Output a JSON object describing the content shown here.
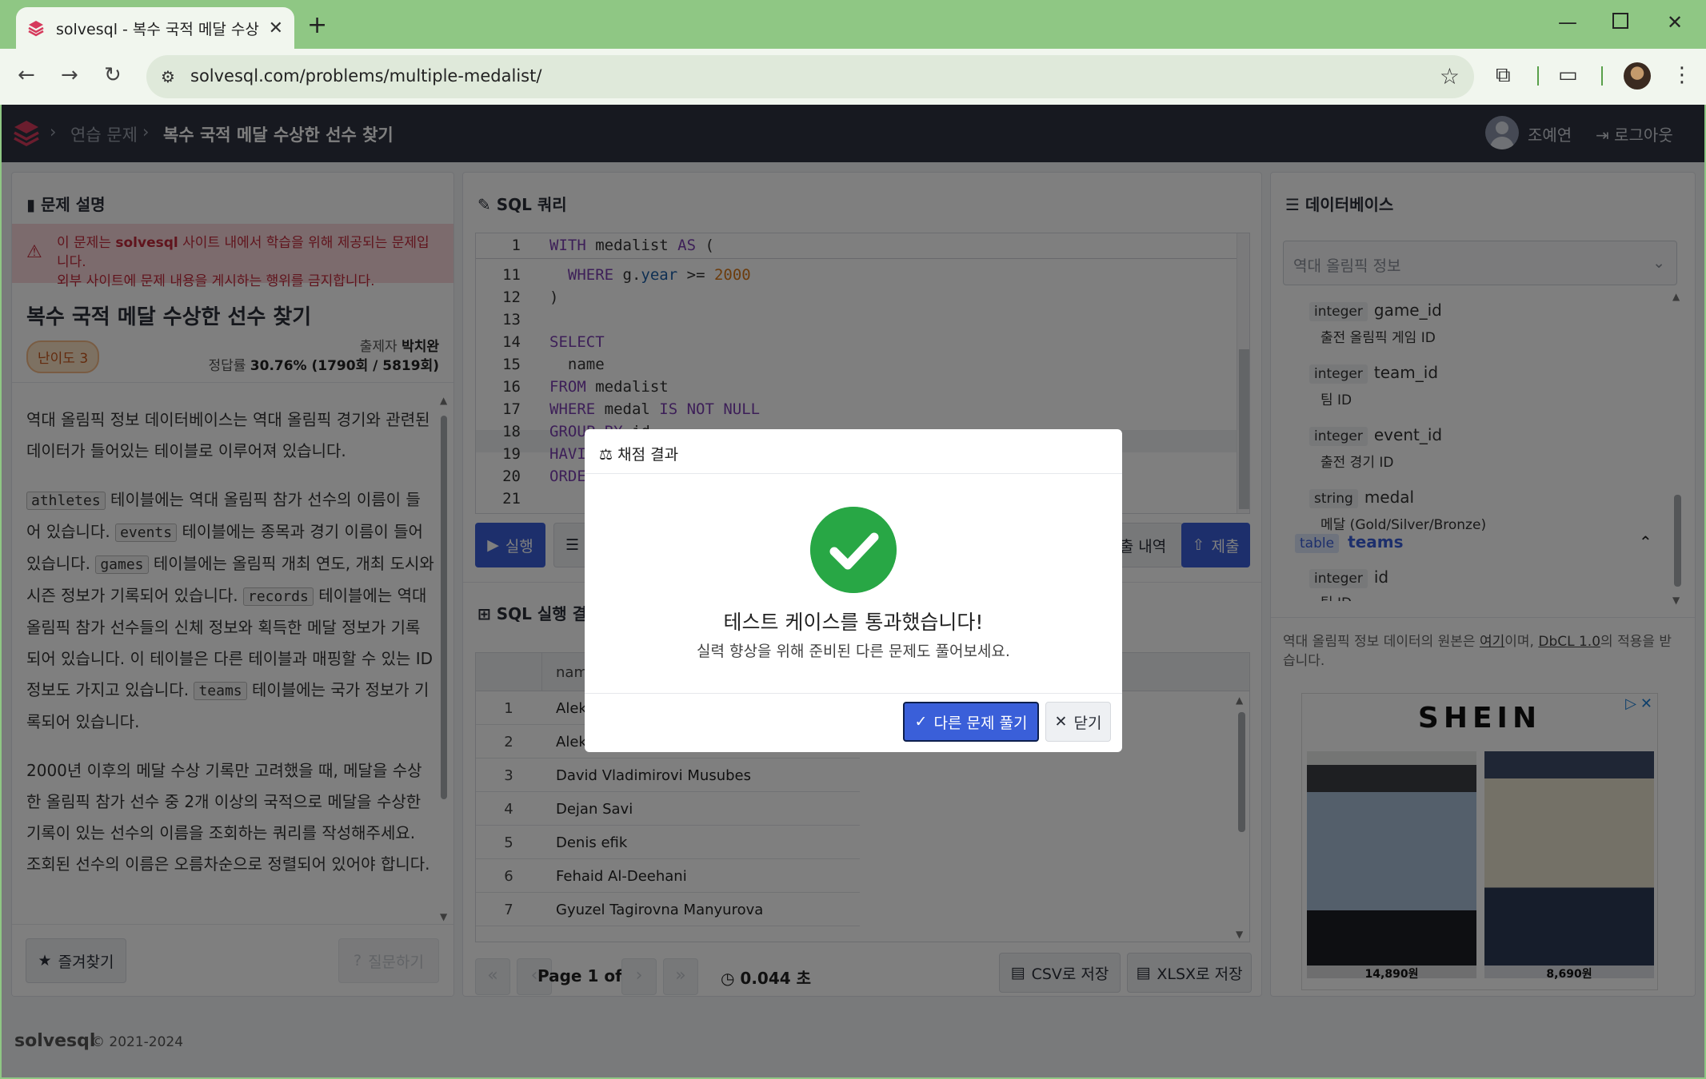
{
  "browser": {
    "tab_title": "solvesql - 복수 국적 메달 수상",
    "url": "solvesql.com/problems/multiple-medalist/"
  },
  "header": {
    "crumb_parent": "연습 문제",
    "crumb_current": "복수 국적 메달 수상한 선수 찾기",
    "user_name": "조예연",
    "logout": "로그아웃"
  },
  "problem": {
    "panel_title": "문제 설명",
    "alert_line1_pre": "이 문제는 ",
    "alert_brand": "solvesql",
    "alert_line1_post": " 사이트 내에서 학습을 위해 제공되는 문제입니다.",
    "alert_line2": "외부 사이트에 문제 내용을 게시하는 행위를 금지합니다.",
    "title": "복수 국적 메달 수상한 선수 찾기",
    "level": "난이도 3",
    "author_label": "출제자",
    "author": "박치완",
    "rate_label": "정답률",
    "rate": "30.76% (1790회 / 5819회)",
    "p1": "역대 올림픽 정보 데이터베이스는 역대 올림픽 경기와 관련된 데이터가 들어있는 테이블로 이루어져 있습니다.",
    "t_athletes": "athletes",
    "p2a": " 테이블에는 역대 올림픽 참가 선수의 이름이 들어 있습니다. ",
    "t_events": "events",
    "p2b": " 테이블에는 종목과 경기 이름이 들어 있습니다. ",
    "t_games": "games",
    "p2c": " 테이블에는 올림픽 개최 연도, 개최 도시와 시즌 정보가 기록되어 있습니다. ",
    "t_records": "records",
    "p2d": " 테이블에는 역대 올림픽 참가 선수들의 신체 정보와 획득한 메달 정보가 기록되어 있습니다. 이 테이블은 다른 테이블과 매핑할 수 있는 ID 정보도 가지고 있습니다. ",
    "t_teams": "teams",
    "p2e": " 테이블에는 국가 정보가 기록되어 있습니다.",
    "p3": "2000년 이후의 메달 수상 기록만 고려했을 때, 메달을 수상한 올림픽 참가 선수 중 2개 이상의 국적으로 메달을 수상한 기록이 있는 선수의 이름을 조회하는 쿼리를 작성해주세요. 조회된 선수의 이름은 오름차순으로 정렬되어 있어야 합니다.",
    "bookmark": "즐겨찾기",
    "ask": "질문하기"
  },
  "editor": {
    "panel_title": "SQL 쿼리",
    "lines": [
      {
        "n": "1",
        "code": "WITH medalist AS ("
      },
      {
        "n": "11",
        "code": "  WHERE g.year >= 2000"
      },
      {
        "n": "12",
        "code": ")"
      },
      {
        "n": "13",
        "code": ""
      },
      {
        "n": "14",
        "code": "SELECT"
      },
      {
        "n": "15",
        "code": "  name"
      },
      {
        "n": "16",
        "code": "FROM medalist"
      },
      {
        "n": "17",
        "code": "WHERE medal IS NOT NULL"
      },
      {
        "n": "18",
        "code": "GROUP BY id"
      },
      {
        "n": "19",
        "code": "HAVING"
      },
      {
        "n": "20",
        "code": "ORDER"
      },
      {
        "n": "21",
        "code": ""
      }
    ],
    "run": "실행",
    "format_label": "S",
    "history": "출 내역",
    "submit": "제출"
  },
  "results": {
    "panel_title": "SQL 실행 결과",
    "col_name": "nam",
    "rows": [
      {
        "i": "1",
        "name": "Alek"
      },
      {
        "i": "2",
        "name": "Alek"
      },
      {
        "i": "3",
        "name": "David Vladimirovi Musubes"
      },
      {
        "i": "4",
        "name": "Dejan Savi"
      },
      {
        "i": "5",
        "name": "Denis efik"
      },
      {
        "i": "6",
        "name": "Fehaid Al-Deehani"
      },
      {
        "i": "7",
        "name": "Gyuzel Tagirovna Manyurova"
      }
    ],
    "page_info": "Page 1 of 1",
    "elapsed": "0.044 초",
    "csv": "CSV로 저장",
    "xlsx": "XLSX로 저장"
  },
  "database": {
    "panel_title": "데이터베이스",
    "selected": "역대 올림픽 정보",
    "columns": [
      {
        "type": "integer",
        "name": "game_id",
        "desc": "출전 올림픽 게임 ID"
      },
      {
        "type": "integer",
        "name": "team_id",
        "desc": "팀 ID"
      },
      {
        "type": "integer",
        "name": "event_id",
        "desc": "출전 경기 ID"
      },
      {
        "type": "string",
        "name": "medal",
        "desc": "메달 (Gold/Silver/Bronze)"
      }
    ],
    "table_badge": "table",
    "table_name": "teams",
    "teams_col": {
      "type": "integer",
      "name": "id",
      "desc": "팀 ID"
    },
    "source_pre": "역대 올림픽 정보 데이터의 원본은 ",
    "source_link": "여기",
    "source_mid": "이며, ",
    "source_license": "DbCL 1.0",
    "source_post": "의 적용을 받습니다."
  },
  "ad": {
    "brand": "SHEIN",
    "price1": "14,890원",
    "price2": "8,690원"
  },
  "footer": {
    "brand": "solvesql",
    "copy": "© 2021-2024"
  },
  "modal": {
    "title": "채점 결과",
    "message": "테스트 케이스를 통과했습니다!",
    "sub": "실력 향상을 위해 준비된 다른 문제도 풀어보세요.",
    "next": "다른 문제 풀기",
    "close": "닫기"
  },
  "colors": {
    "accent": "#3a5fd9",
    "success": "#28a745",
    "danger": "#c0283a",
    "header_bg": "#2f3340"
  }
}
